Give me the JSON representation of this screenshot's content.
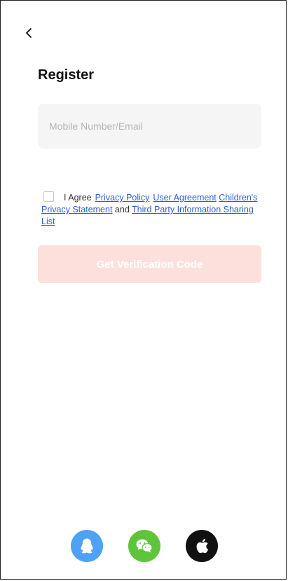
{
  "header": {
    "title": "Register"
  },
  "form": {
    "account_placeholder": "Mobile Number/Email",
    "account_value": ""
  },
  "agreement": {
    "checked": false,
    "prefix": "I Agree",
    "privacy_policy": "Privacy Policy",
    "user_agreement": "User Agreement",
    "childrens_privacy": "Children's Privacy Statement",
    "and_text": "and",
    "third_party": "Third Party Information Sharing List"
  },
  "actions": {
    "get_code_label": "Get Verification Code"
  },
  "social": {
    "icons": [
      "qq-icon",
      "wechat-icon",
      "apple-icon"
    ]
  },
  "colors": {
    "button_disabled": "#fde0dc",
    "link": "#2a5fd6",
    "qq": "#4da2f6",
    "wechat": "#5fc43b",
    "apple": "#111111",
    "input_bg": "#f5f5f5"
  }
}
